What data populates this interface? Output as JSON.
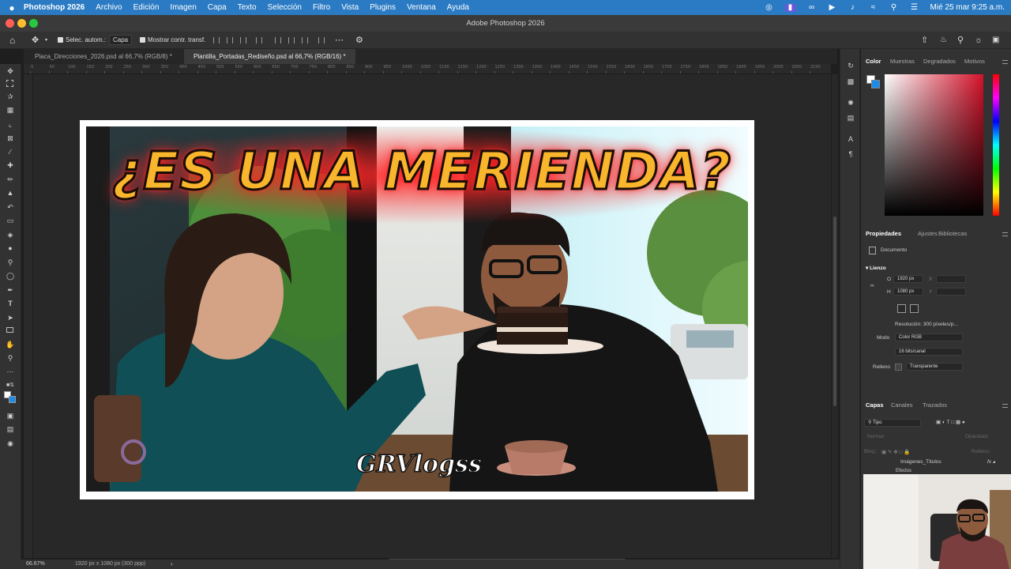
{
  "menubar": {
    "app_name": "Photoshop 2026",
    "items": [
      "Archivo",
      "Edición",
      "Imagen",
      "Capa",
      "Texto",
      "Selección",
      "Filtro",
      "Vista",
      "Plugins",
      "Ventana",
      "Ayuda"
    ],
    "clock": "Mié 25 mar 9:25 a.m.",
    "color": "#2b7bc4"
  },
  "window": {
    "title": "Adobe Photoshop 2026"
  },
  "options_bar": {
    "auto_select_label": "Selec. autom.:",
    "auto_select_value": "Capa",
    "transform_label": "Mostrar contr. transf."
  },
  "tabs": [
    {
      "label": "Placa_Direcciones_2026.psd al 66,7% (RGB/8) *",
      "active": false
    },
    {
      "label": "Plantilla_Portadas_Rediseño.psd al 66,7% (RGB/16) *",
      "active": true
    }
  ],
  "ruler": {
    "labels": [
      "0",
      "50",
      "100",
      "150",
      "200",
      "250",
      "300",
      "350",
      "400",
      "450",
      "500",
      "550",
      "600",
      "650",
      "700",
      "750",
      "800",
      "850",
      "900",
      "950",
      "1000",
      "1050",
      "1100",
      "1150",
      "1200",
      "1250",
      "1300",
      "1350",
      "1400",
      "1450",
      "1500",
      "1550",
      "1600",
      "1650",
      "1700",
      "1750",
      "1800",
      "1850",
      "1900",
      "1950",
      "2000",
      "2050",
      "2100"
    ]
  },
  "thumbnail": {
    "headline": "¿ES UNA MERIENDA?",
    "watermark": "GRVlogss"
  },
  "status": {
    "zoom": "66.67%",
    "doc_info": "1920 px x 1080 px (300 ppp)"
  },
  "color_panel": {
    "tabs": [
      "Color",
      "Muestras",
      "Degradados",
      "Motivos"
    ],
    "active_color": "#d5122a"
  },
  "properties_panel": {
    "tabs": [
      "Propiedades",
      "Ajustes",
      "Bibliotecas"
    ],
    "doc_label": "Documento",
    "section": "Lienzo",
    "width_label": "O",
    "width_value": "1920 px",
    "height_label": "H",
    "height_value": "1080 px",
    "x_label": "X",
    "y_label": "Y",
    "resolution": "Resolución: 300 píxeles/p...",
    "mode_label": "Modo",
    "mode_value": "Color RGB",
    "depth_value": "16 bits/canal",
    "fill_label": "Relleno",
    "fill_value": "Transparente"
  },
  "layers_panel": {
    "tabs": [
      "Capas",
      "Canales",
      "Trazados"
    ],
    "filter_label": "Tipo",
    "blend_mode": "Normal",
    "opacity_label": "Opacidad:",
    "lock_label": "Bloq.:",
    "fill_label": "Relleno:",
    "layer_name": "Imágenes_Títulos",
    "effects_label": "Efectos"
  }
}
